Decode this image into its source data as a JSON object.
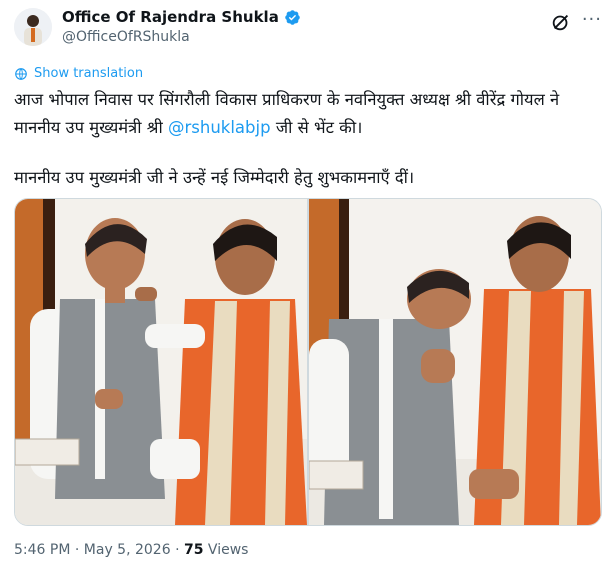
{
  "author": {
    "name": "Office Of Rajendra Shukla",
    "handle": "@OfficeOfRShukla",
    "verified": true,
    "verified_color": "#1d9bf0"
  },
  "translate_label": "Show translation",
  "tweet": {
    "line1_pre": "आज भोपाल निवास पर सिंगरौली विकास प्राधिकरण के नवनियुक्त अध्यक्ष श्री वीरेंद्र गोयल ने माननीय उप मुख्यमंत्री श्री ",
    "mention": "@rshuklabjp",
    "line1_post": " जी से भेंट की।",
    "line2": "माननीय उप मुख्यमंत्री जी ने उन्हें नई जिम्मेदारी हेतु शुभकामनाएँ दीं।"
  },
  "media": {
    "photos": [
      {
        "name": "photo-sweet-offering"
      },
      {
        "name": "photo-greeting-namaste"
      }
    ]
  },
  "meta": {
    "time": "5:46 PM",
    "date": "May 5, 2026",
    "views_count": "75",
    "views_label": "Views",
    "separator": "·"
  },
  "colors": {
    "link": "#1d9bf0",
    "muted": "#536471",
    "text": "#0f1419"
  }
}
